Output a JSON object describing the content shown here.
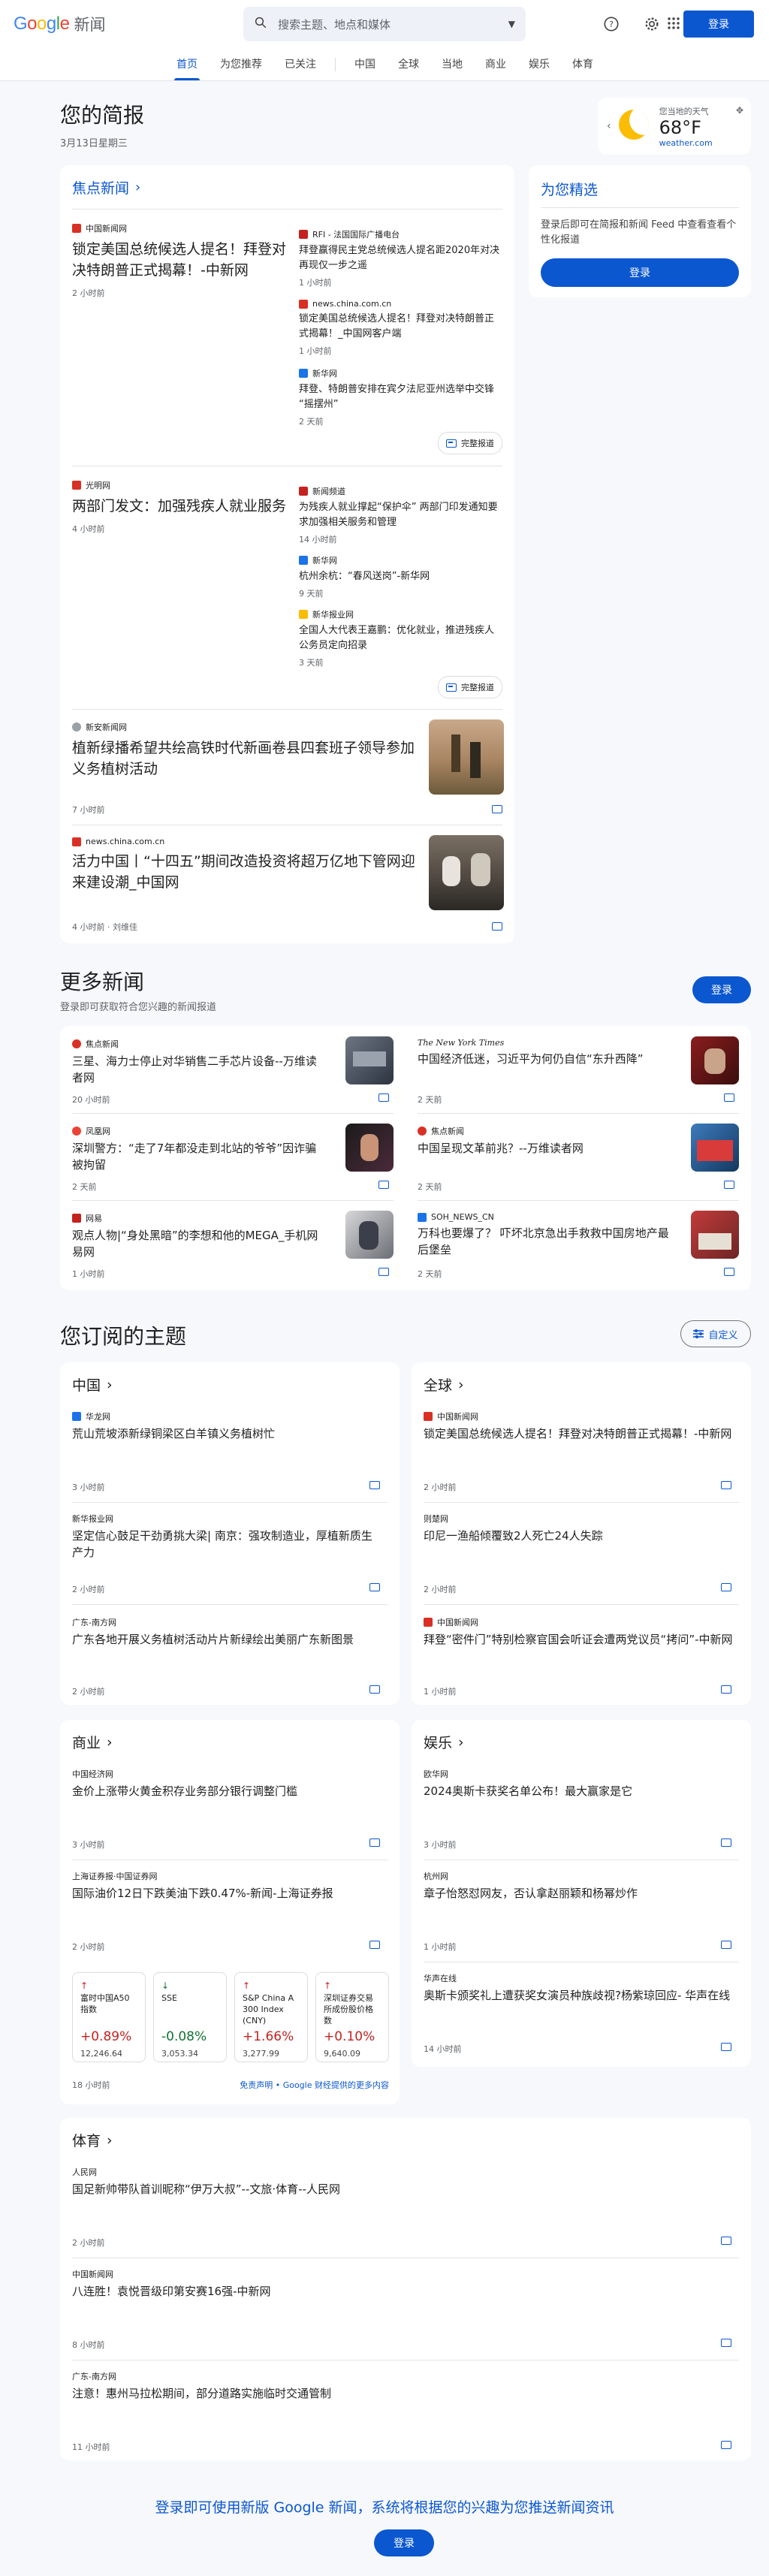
{
  "header": {
    "logo_g": "Google",
    "logo_text": "新闻",
    "search_placeholder": "搜索主题、地点和媒体",
    "signin": "登录"
  },
  "nav": {
    "tabs": [
      "首页",
      "为您推荐",
      "已关注",
      "中国",
      "全球",
      "当地",
      "商业",
      "娱乐",
      "体育"
    ],
    "active": "首页"
  },
  "briefing": {
    "title": "您的简报",
    "date": "3月13日星期三",
    "weather": {
      "label": "您当地的天气",
      "temp": "68°F",
      "source": "weather.com"
    }
  },
  "top_stories": {
    "label": "焦点新闻",
    "clusters": [
      {
        "main": {
          "publisher": "中国新闻网",
          "title": "锁定美国总统候选人提名！拜登对决特朗普正式揭幕！-中新网",
          "time": "2 小时前"
        },
        "side": [
          {
            "publisher": "RFI - 法国国际广播电台",
            "title": "拜登赢得民主党总统候选人提名距2020年对决再现仅一步之遥",
            "time": "1 小时前"
          },
          {
            "publisher": "news.china.com.cn",
            "title": "锁定美国总统候选人提名！拜登对决特朗普正式揭幕！_中国网客户端",
            "time": "1 小时前"
          },
          {
            "publisher": "新华网",
            "title": "拜登、特朗普安排在宾夕法尼亚州选举中交锋 “摇摆州”",
            "time": "2 天前"
          }
        ],
        "full_coverage": "完整报道"
      },
      {
        "main": {
          "publisher": "光明网",
          "title": "两部门发文：加强残疾人就业服务",
          "time": "4 小时前"
        },
        "side": [
          {
            "publisher": "新闻频道",
            "title": "为残疾人就业撑起“保护伞” 两部门印发通知要求加强相关服务和管理",
            "time": "14 小时前"
          },
          {
            "publisher": "新华网",
            "title": "杭州余杭：“春风送岗”-新华网",
            "time": "9 天前"
          },
          {
            "publisher": "新华报业网",
            "title": "全国人大代表王嘉鹏：优化就业，推进残疾人公务员定向招录",
            "time": "3 天前"
          }
        ],
        "full_coverage": "完整报道"
      }
    ],
    "singles": [
      {
        "publisher": "新安新闻网",
        "title": "植新绿播希望共绘高铁时代新画卷县四套班子领导参加义务植树活动",
        "time": "7 小时前"
      },
      {
        "publisher": "news.china.com.cn",
        "title": "活力中国丨“十四五”期间改造投资将超万亿地下管网迎来建设潮_中国网",
        "time": "4 小时前 · 刘维佳"
      }
    ]
  },
  "for_you": {
    "title": "为您精选",
    "text": "登录后即可在简报和新闻 Feed 中查看查看个性化报道",
    "button": "登录"
  },
  "more_news": {
    "title": "更多新闻",
    "subtitle": "登录即可获取符合您兴趣的新闻报道",
    "button": "登录",
    "items": [
      {
        "publisher": "焦点新闻",
        "title": "三星、海力士停止对华销售二手芯片设备--万维读者网",
        "time": "20 小时前"
      },
      {
        "publisher": "The New York Times",
        "title": "中国经济低迷，习近平为何仍自信“东升西降”",
        "time": "2 天前"
      },
      {
        "publisher": "凤凰网",
        "title": "深圳警方：“走了7年都没走到北站的爷爷”因诈骗被拘留",
        "time": "2 天前"
      },
      {
        "publisher": "焦点新闻",
        "title": "中国呈现文革前兆？--万维读者网",
        "time": "2 天前"
      },
      {
        "publisher": "网易",
        "title": "观点人物|“身处黑暗”的李想和他的MEGA_手机网易网",
        "time": "1 小时前"
      },
      {
        "publisher": "SOH_NEWS_CN",
        "title": "万科也要爆了？ 吓坏北京急出手救救中国房地产最后堡垒",
        "time": "2 天前"
      }
    ]
  },
  "topics": {
    "title": "您订阅的主题",
    "customize": "自定义",
    "china": {
      "label": "中国",
      "items": [
        {
          "publisher": "华龙网",
          "title": "荒山荒坡添新绿铜梁区白羊镇义务植树忙",
          "time": "3 小时前"
        },
        {
          "publisher": "新华报业网",
          "title": "坚定信心鼓足干劲勇挑大梁| 南京：强攻制造业，厚植新质生产力",
          "time": "2 小时前"
        },
        {
          "publisher": "广东-南方网",
          "title": "广东各地开展义务植树活动片片新绿绘出美丽广东新图景",
          "time": "2 小时前"
        }
      ]
    },
    "world": {
      "label": "全球",
      "items": [
        {
          "publisher": "中国新闻网",
          "title": "锁定美国总统候选人提名！拜登对决特朗普正式揭幕！-中新网",
          "time": "2 小时前"
        },
        {
          "publisher": "则楚网",
          "title": "印尼一渔船倾覆致2人死亡24人失踪",
          "time": "2 小时前"
        },
        {
          "publisher": "中国新闻网",
          "title": "拜登“密件门”特别检察官国会听证会遭两党议员“拷问”-中新网",
          "time": "1 小时前"
        }
      ]
    },
    "business": {
      "label": "商业",
      "items": [
        {
          "publisher": "中国经济网",
          "title": "金价上涨带火黄金积存业务部分银行调整门槛",
          "time": "3 小时前"
        },
        {
          "publisher": "上海证券报·中国证券网",
          "title": "国际油价12日下跌美油下跌0.47%-新闻-上海证券报",
          "time": "2 小时前"
        }
      ],
      "tickers": [
        {
          "name": "富时中国A50指数",
          "change": "+0.89%",
          "price": "12,246.64",
          "dir": "up"
        },
        {
          "name": "SSE",
          "change": "-0.08%",
          "price": "3,053.34",
          "dir": "down"
        },
        {
          "name": "S&P China A 300 Index (CNY)",
          "change": "+1.66%",
          "price": "3,277.99",
          "dir": "up"
        },
        {
          "name": "深圳证券交易所成份股价格数",
          "change": "+0.10%",
          "price": "9,640.09",
          "dir": "up"
        }
      ],
      "ticker_time": "18 小时前",
      "disclaimer": "免责声明 • Google 财经提供的更多内容"
    },
    "entertainment": {
      "label": "娱乐",
      "items": [
        {
          "publisher": "欧华网",
          "title": "2024奥斯卡获奖名单公布！最大赢家是它",
          "time": "3 小时前"
        },
        {
          "publisher": "杭州网",
          "title": "章子怡怒怼网友，否认拿赵丽颖和杨幂炒作",
          "time": "1 小时前"
        },
        {
          "publisher": "华声在线",
          "title": "奥斯卡颁奖礼上遭获奖女演员种族歧视?杨紫琼回应- 华声在线",
          "time": "14 小时前"
        }
      ]
    },
    "sports": {
      "label": "体育",
      "items": [
        {
          "publisher": "人民网",
          "title": "国足新帅带队首训昵称“伊万大叔”--文旅·体育--人民网",
          "time": "2 小时前"
        },
        {
          "publisher": "中国新闻网",
          "title": "八连胜！袁悦晋级印第安赛16强-中新网",
          "time": "8 小时前"
        },
        {
          "publisher": "广东-南方网",
          "title": "注意！惠州马拉松期间，部分道路实施临时交通管制",
          "time": "11 小时前"
        }
      ]
    }
  },
  "footer": {
    "text": "登录即可使用新版 Google 新闻，系统将根据您的兴趣为您推送新闻资讯",
    "button": "登录"
  },
  "colors": {
    "accent": "#0b57d0",
    "up": "#c5221f",
    "down": "#137333"
  }
}
